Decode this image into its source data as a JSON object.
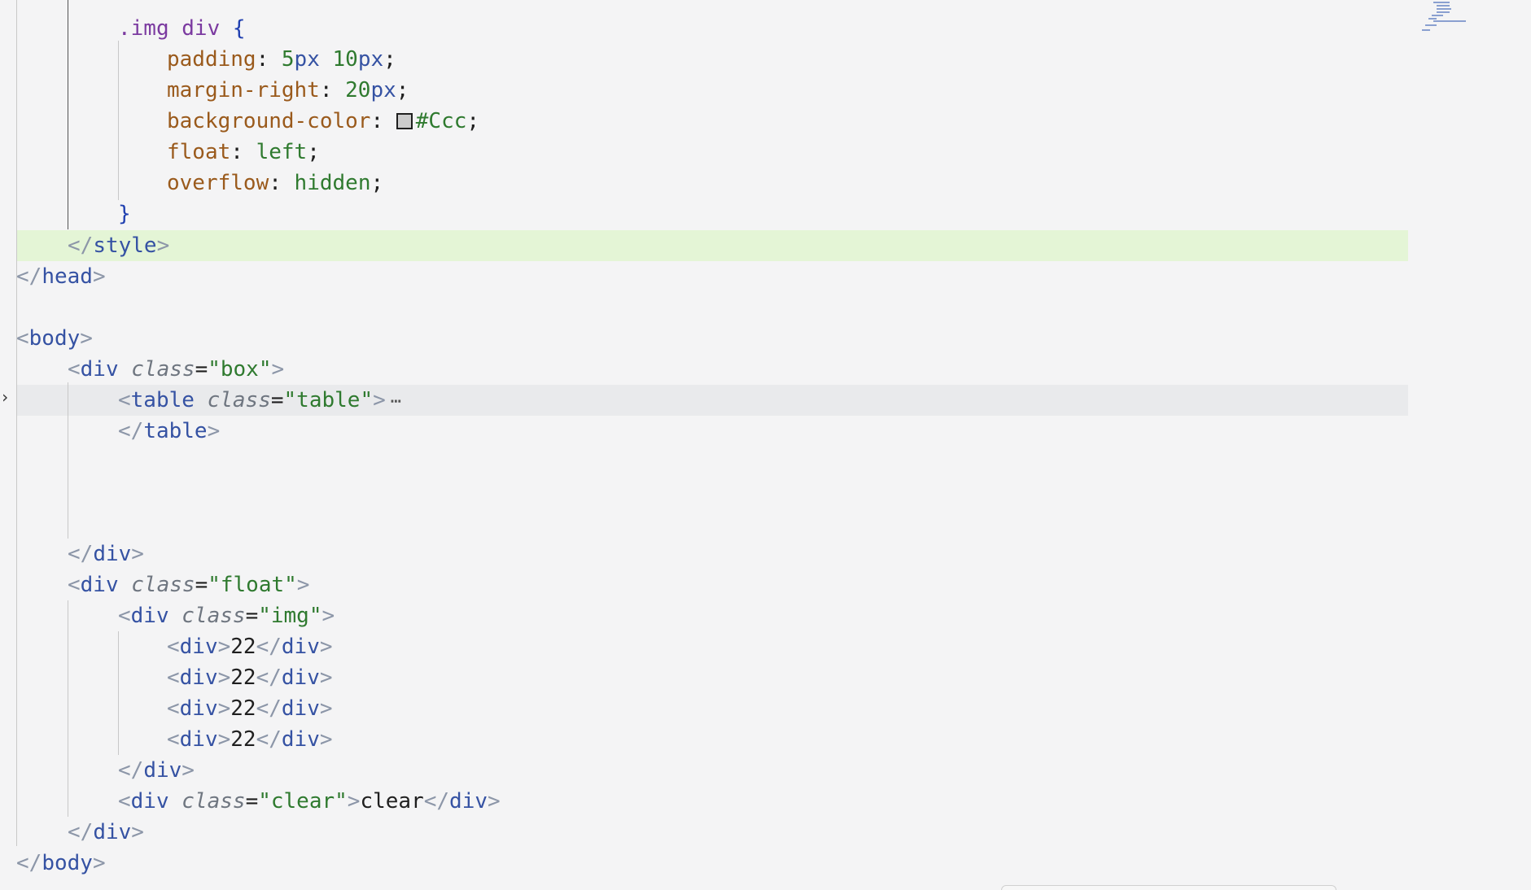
{
  "editor": {
    "lines": {
      "l1": {
        "selector": ".img div",
        "brace": "{"
      },
      "l2": {
        "prop": "padding",
        "num1": "5",
        "unit1": "px",
        "num2": "10",
        "unit2": "px"
      },
      "l3": {
        "prop": "margin-right",
        "num": "20",
        "unit": "px"
      },
      "l4": {
        "prop": "background-color",
        "value": "#Ccc",
        "swatch_color": "#cccccc"
      },
      "l5": {
        "prop": "float",
        "value": "left"
      },
      "l6": {
        "prop": "overflow",
        "value": "hidden"
      },
      "l7": {
        "brace": "}"
      },
      "l8": {
        "tag": "style"
      },
      "l9": {
        "tag": "head"
      },
      "l10": {
        "tag": "body"
      },
      "l11": {
        "tag": "div",
        "attr": "class",
        "value": "\"box\""
      },
      "l12": {
        "tag": "table",
        "attr": "class",
        "value": "\"table\"",
        "fold": "⋯"
      },
      "l13": {
        "tag": "table"
      },
      "l14": {
        "tag": "div"
      },
      "l15": {
        "tag": "div",
        "attr": "class",
        "value": "\"float\""
      },
      "l16": {
        "tag": "div",
        "attr": "class",
        "value": "\"img\""
      },
      "l17": {
        "tag": "div",
        "text": "22"
      },
      "l18": {
        "tag": "div",
        "text": "22"
      },
      "l19": {
        "tag": "div",
        "text": "22"
      },
      "l20": {
        "tag": "div",
        "text": "22"
      },
      "l21": {
        "tag": "div"
      },
      "l22": {
        "tag": "div",
        "attr": "class",
        "value": "\"clear\"",
        "text": "clear"
      },
      "l23": {
        "tag": "div"
      },
      "l24": {
        "tag": "body"
      }
    },
    "fold_icon": "chevron-right-icon",
    "colors": {
      "active_line": "#e4f5d6",
      "folded_line": "#e9eaec",
      "tag": "#3552a3",
      "string": "#2f7a2f",
      "property": "#9a5a1c",
      "selector": "#7b3aa0"
    }
  }
}
